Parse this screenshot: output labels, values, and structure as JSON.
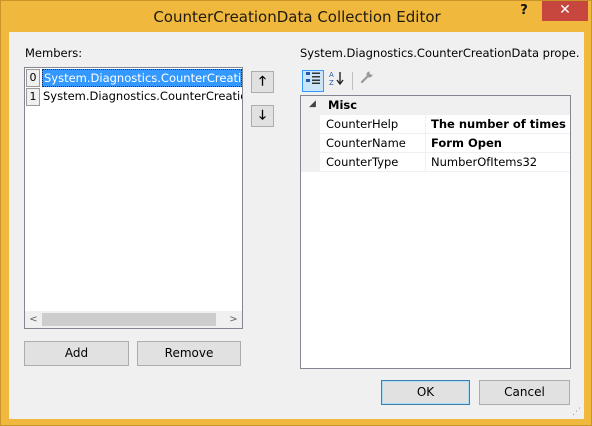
{
  "window": {
    "title": "CounterCreationData Collection Editor",
    "help_glyph": "?",
    "close_glyph": "✕"
  },
  "members": {
    "label": "Members:",
    "items": [
      {
        "index": "0",
        "text": "System.Diagnostics.CounterCreationData",
        "selected": true
      },
      {
        "index": "1",
        "text": "System.Diagnostics.CounterCreationData",
        "selected": false
      }
    ],
    "scroll_left": "<",
    "scroll_right": ">"
  },
  "move_up_glyph": "🡑",
  "move_down_glyph": "🡓",
  "add_label": "Add",
  "remove_label": "Remove",
  "properties": {
    "label": "System.Diagnostics.CounterCreationData prope...",
    "toolbar": {
      "categorized_icon": "categorized-icon",
      "alphabetical_icon": "alphabetical-icon",
      "property_pages_icon": "wrench-icon"
    },
    "category": {
      "toggle": "◢",
      "label": "Misc"
    },
    "rows": [
      {
        "name": "CounterHelp",
        "value": "The number of times the",
        "bold": true
      },
      {
        "name": "CounterName",
        "value": "Form Open",
        "bold": true
      },
      {
        "name": "CounterType",
        "value": "NumberOfItems32",
        "bold": false
      }
    ]
  },
  "ok_label": "OK",
  "cancel_label": "Cancel",
  "colors": {
    "titlebar": "#f0b83c",
    "close": "#c7473f",
    "selection": "#3399ff"
  }
}
